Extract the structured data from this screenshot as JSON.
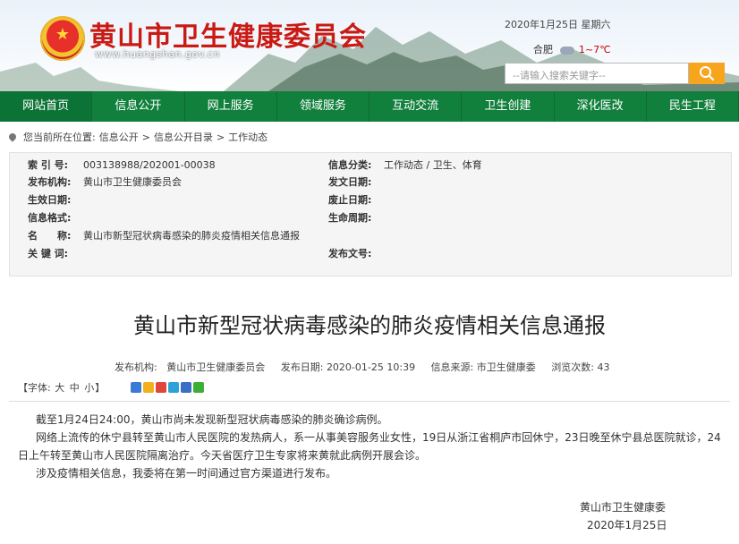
{
  "header": {
    "site_title": "黄山市卫生健康委员会",
    "site_url": "www.huangshan.gov.cn",
    "date": "2020年1月25日 星期六",
    "weather_city": "合肥",
    "weather_temp": "1~7℃",
    "weather_icon": "cloud-icon",
    "search_placeholder": "--请输入搜索关键字--"
  },
  "nav": [
    "网站首页",
    "信息公开",
    "网上服务",
    "领域服务",
    "互动交流",
    "卫生创建",
    "深化医改",
    "民生工程"
  ],
  "breadcrumb": {
    "prefix": "您当前所在位置:",
    "items": [
      "信息公开",
      "信息公开目录",
      "工作动态"
    ],
    "separator": ">"
  },
  "meta": {
    "left": [
      {
        "label": "索 引 号:",
        "value": "003138988/202001-00038"
      },
      {
        "label": "发布机构:",
        "value": "黄山市卫生健康委员会"
      },
      {
        "label": "生效日期:",
        "value": ""
      },
      {
        "label": "信息格式:",
        "value": ""
      },
      {
        "label": "名　　称:",
        "value": "黄山市新型冠状病毒感染的肺炎疫情相关信息通报"
      },
      {
        "label": "关 键 词:",
        "value": ""
      }
    ],
    "right": [
      {
        "label": "信息分类:",
        "value": "工作动态 / 卫生、体育"
      },
      {
        "label": "发文日期:",
        "value": ""
      },
      {
        "label": "废止日期:",
        "value": ""
      },
      {
        "label": "生命周期:",
        "value": ""
      },
      {
        "label": "",
        "value": ""
      },
      {
        "label": "发布文号:",
        "value": ""
      }
    ]
  },
  "article": {
    "title": "黄山市新型冠状病毒感染的肺炎疫情相关信息通报",
    "info": {
      "org_label": "发布机构:",
      "org": "黄山市卫生健康委员会",
      "date_label": "发布日期:",
      "date": "2020-01-25 10:39",
      "source_label": "信息来源:",
      "source": "市卫生健康委",
      "views_label": "浏览次数:",
      "views": "43"
    },
    "fontsize": {
      "prefix": "【字体:",
      "large": "大",
      "medium": "中",
      "small": "小",
      "suffix": "】"
    },
    "paragraphs": [
      "截至1月24日24:00，黄山市尚未发现新型冠状病毒感染的肺炎确诊病例。",
      "网络上流传的休宁县转至黄山市人民医院的发热病人，系一从事美容服务业女性，19日从浙江省桐庐市回休宁，23日晚至休宁县总医院就诊，24日上午转至黄山市人民医院隔离治疗。今天省医疗卫生专家将来黄就此病例开展会诊。",
      "涉及疫情相关信息，我委将在第一时间通过官方渠道进行发布。"
    ],
    "sign_org": "黄山市卫生健康委",
    "sign_date": "2020年1月25日"
  },
  "colors": {
    "nav_bg": "#12803d",
    "title_red": "#c91a14",
    "search_btn": "#f7a51d"
  }
}
